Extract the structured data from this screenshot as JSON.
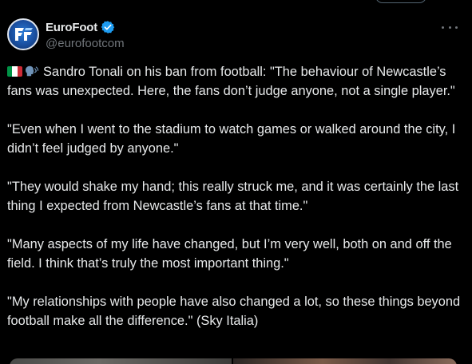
{
  "account": {
    "display_name": "EuroFoot",
    "handle": "@eurofootcom",
    "avatar_icon": "eurofoot-logo-icon",
    "verified_icon": "verified-badge-icon",
    "accent_color": "#1d9bf0"
  },
  "menu": {
    "more_icon": "more-options-icon"
  },
  "tweet": {
    "lead_emojis": [
      "italian-flag-icon",
      "speaking-head-icon"
    ],
    "paragraphs": [
      "Sandro Tonali on his ban from football: \"The behaviour of Newcastle’s fans was unexpected. Here, the fans don’t judge anyone, not a single player.\"",
      "\"Even when I went to the stadium to watch games or walked around the city, I didn’t feel judged by anyone.\"",
      "\"They would shake my hand; this really struck me, and it was certainly the last thing I expected from Newcastle’s fans at that time.\"",
      "\"Many aspects of my life have changed, but I’m very well, both on and off the field. I think that’s truly the most important thing.\"",
      "\"My relationships with people have also changed a lot, so these things beyond football make all the difference.\" (Sky Italia)"
    ]
  },
  "colors": {
    "background": "#000000",
    "text_primary": "#e7e9ea",
    "text_secondary": "#71767b"
  }
}
